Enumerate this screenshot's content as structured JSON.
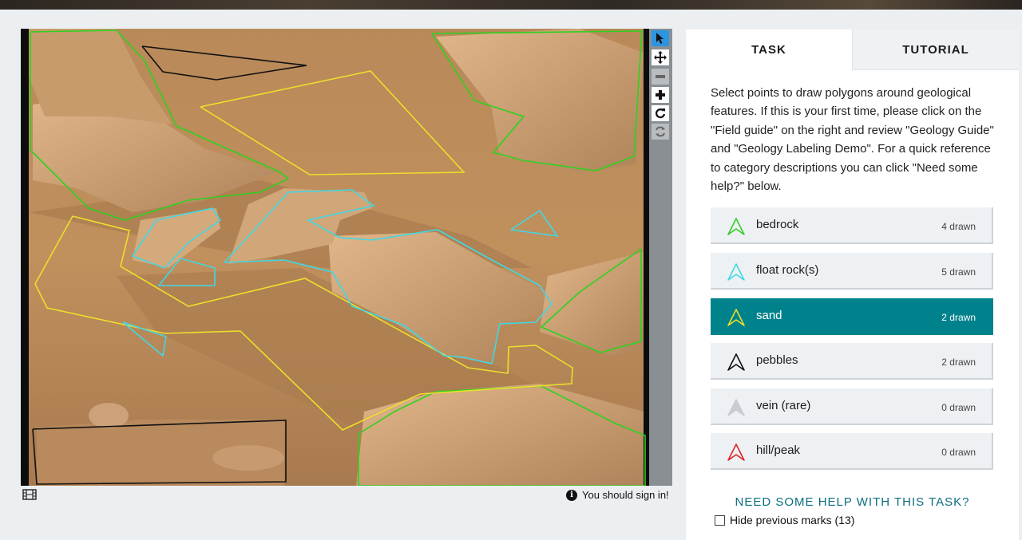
{
  "tabs": {
    "task": "TASK",
    "tutorial": "TUTORIAL"
  },
  "instructions": "Select points to draw polygons around geological features. If this is your first time, please click on the \"Field guide\" on the right and review \"Geology Guide\" and \"Geology Labeling Demo\". For a quick reference to category descriptions you can click \"Need some help?\" below.",
  "choices": [
    {
      "label": "bedrock",
      "count": "4 drawn",
      "color": "#2ed11f"
    },
    {
      "label": "float rock(s)",
      "count": "5 drawn",
      "color": "#3fd8e6"
    },
    {
      "label": "sand",
      "count": "2 drawn",
      "color": "#ecdf2a",
      "selected": true
    },
    {
      "label": "pebbles",
      "count": "2 drawn",
      "color": "#111111"
    },
    {
      "label": "vein (rare)",
      "count": "0 drawn",
      "color": "#c9cdd1"
    },
    {
      "label": "hill/peak",
      "count": "0 drawn",
      "color": "#e02424"
    }
  ],
  "help_link": "NEED SOME HELP WITH THIS TASK?",
  "hide_previous": "Hide previous marks (13)",
  "sign_in": "You should sign in!",
  "tools": [
    "pointer-icon",
    "move-icon",
    "zoom-out-icon",
    "zoom-in-icon",
    "rotate-icon",
    "reset-icon"
  ],
  "colors": {
    "accent": "#00828c",
    "tool_active": "#2d95e0"
  }
}
